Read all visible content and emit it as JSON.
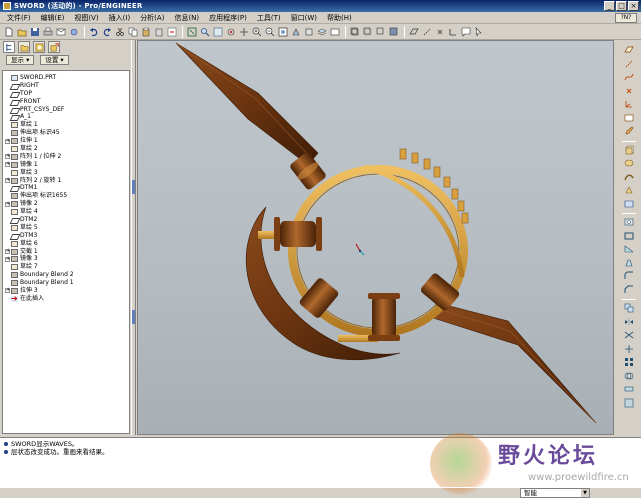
{
  "window": {
    "title": "SWORD (活动的) - Pro/ENGINEER",
    "buttons": [
      "_",
      "□",
      "×"
    ]
  },
  "menubar": {
    "items": [
      "文件(F)",
      "编辑(E)",
      "视图(V)",
      "插入(I)",
      "分析(A)",
      "信息(N)",
      "应用程序(P)",
      "工具(T)",
      "窗口(W)",
      "帮助(H)"
    ],
    "help_badge": "?N?"
  },
  "tree_controls": {
    "show_label": "显示 ▾",
    "settings_label": "设置 ▾"
  },
  "model_tree": [
    {
      "label": "SWORD.PRT",
      "type": "part",
      "expandable": false
    },
    {
      "label": "RIGHT",
      "type": "datum",
      "expandable": false
    },
    {
      "label": "TOP",
      "type": "datum",
      "expandable": false
    },
    {
      "label": "FRONT",
      "type": "datum",
      "expandable": false
    },
    {
      "label": "PRT_CSYS_DEF",
      "type": "csys",
      "expandable": false
    },
    {
      "label": "A_1",
      "type": "axis",
      "expandable": false
    },
    {
      "label": "草绘 1",
      "type": "sketch",
      "expandable": false
    },
    {
      "label": "伸出项 标识45",
      "type": "feat",
      "expandable": false
    },
    {
      "label": "拉伸 1",
      "type": "feat",
      "expandable": true
    },
    {
      "label": "草绘 2",
      "type": "sketch",
      "expandable": false
    },
    {
      "label": "阵列 1 / 拉伸 2",
      "type": "feat",
      "expandable": true
    },
    {
      "label": "镜像 1",
      "type": "feat",
      "expandable": true
    },
    {
      "label": "草绘 3",
      "type": "sketch",
      "expandable": false
    },
    {
      "label": "阵列 2 / 旋转 1",
      "type": "feat",
      "expandable": true
    },
    {
      "label": "DTM1",
      "type": "datum",
      "expandable": false
    },
    {
      "label": "伸出项 标识1655",
      "type": "feat",
      "expandable": false
    },
    {
      "label": "镜像 2",
      "type": "feat",
      "expandable": true
    },
    {
      "label": "草绘 4",
      "type": "sketch",
      "expandable": false
    },
    {
      "label": "DTM2",
      "type": "datum",
      "expandable": false
    },
    {
      "label": "草绘 5",
      "type": "sketch",
      "expandable": false
    },
    {
      "label": "DTM3",
      "type": "datum",
      "expandable": false
    },
    {
      "label": "草绘 6",
      "type": "sketch",
      "expandable": false
    },
    {
      "label": "交截 1",
      "type": "feat",
      "expandable": true
    },
    {
      "label": "镜像 3",
      "type": "feat",
      "expandable": true
    },
    {
      "label": "草绘 7",
      "type": "sketch",
      "expandable": false
    },
    {
      "label": "Boundary Blend 2",
      "type": "feat",
      "expandable": false
    },
    {
      "label": "Boundary Blend 1",
      "type": "feat",
      "expandable": false
    },
    {
      "label": "拉伸 3",
      "type": "feat",
      "expandable": true
    },
    {
      "label": "在此插入",
      "type": "insert",
      "expandable": false
    }
  ],
  "messages": [
    "SWORD显示WAVES。",
    "层状态改变成功。重画来看结果。"
  ],
  "watermark": {
    "title": "野火论坛",
    "url": "www.proewildfire.cn"
  },
  "status": {
    "filter_value": "智能"
  },
  "colors": {
    "model_brown": "#6b3410",
    "model_gold": "#d9a040",
    "titlebar": "#0a246a"
  }
}
